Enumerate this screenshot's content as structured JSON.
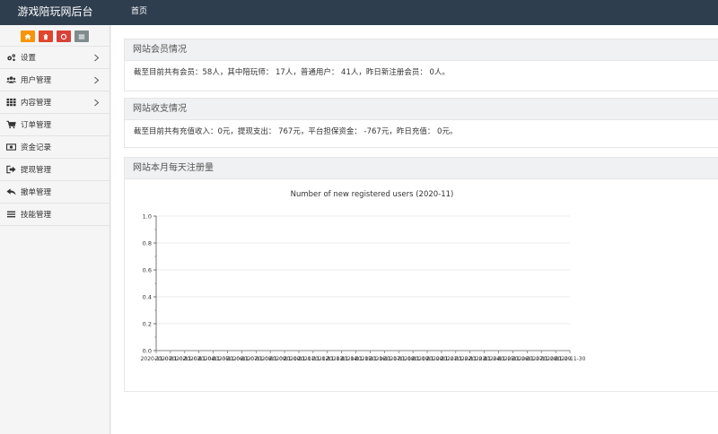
{
  "brand": "游戏陪玩网后台",
  "nav": {
    "home": "首页"
  },
  "shortcuts": [
    {
      "icon": "home-icon",
      "color": "#f89406"
    },
    {
      "icon": "trash-icon",
      "color": "#e0452d"
    },
    {
      "icon": "recycle-icon",
      "color": "#d9403a"
    },
    {
      "icon": "list-icon",
      "color": "#7f8c8d"
    }
  ],
  "menu": [
    {
      "label": "设置",
      "icon": "gears-icon",
      "has_children": true
    },
    {
      "label": "用户管理",
      "icon": "users-icon",
      "has_children": true
    },
    {
      "label": "内容管理",
      "icon": "grid-icon",
      "has_children": true
    },
    {
      "label": "订单管理",
      "icon": "cart-icon",
      "has_children": false
    },
    {
      "label": "资金记录",
      "icon": "money-icon",
      "has_children": false
    },
    {
      "label": "提现管理",
      "icon": "sign-out-icon",
      "has_children": false
    },
    {
      "label": "撤单管理",
      "icon": "reply-icon",
      "has_children": false
    },
    {
      "label": "技能管理",
      "icon": "bars-icon",
      "has_children": false
    }
  ],
  "members": {
    "title": "网站会员情况",
    "text": "截至目前共有会员：58人，其中陪玩师： 17人，普通用户： 41人，昨日新注册会员： 0人。"
  },
  "finance": {
    "title": "网站收支情况",
    "text": "截至目前共有充值收入：0元，提现支出： 767元，平台担保资金： -767元，昨日充值： 0元。"
  },
  "registrations": {
    "title": "网站本月每天注册量"
  },
  "chart_data": {
    "type": "line",
    "title": "Number of new registered users (2020-11)",
    "xlabel": "",
    "ylabel": "",
    "ylim": [
      0,
      1
    ],
    "yticks": [
      "0.0",
      "0.2",
      "0.4",
      "0.6",
      "0.8",
      "1.0"
    ],
    "categories": [
      "2020-11-01",
      "2020-11-02",
      "2020-11-03",
      "2020-11-04",
      "2020-11-05",
      "2020-11-06",
      "2020-11-07",
      "2020-11-08",
      "2020-11-09",
      "2020-11-10",
      "2020-11-11",
      "2020-11-12",
      "2020-11-13",
      "2020-11-14",
      "2020-11-15",
      "2020-11-16",
      "2020-11-17",
      "2020-11-18",
      "2020-11-19",
      "2020-11-20",
      "2020-11-21",
      "2020-11-22",
      "2020-11-23",
      "2020-11-24",
      "2020-11-25",
      "2020-11-26",
      "2020-11-27",
      "2020-11-28",
      "2020-11-29",
      "2020-11-30"
    ],
    "values": [
      0,
      0,
      0,
      0,
      0,
      0,
      0,
      0,
      0,
      0,
      0,
      0,
      0,
      0,
      0,
      0,
      0,
      0,
      0,
      0,
      0,
      0,
      0,
      0,
      0,
      0,
      0,
      0,
      0,
      0
    ],
    "grid": true,
    "colors": {
      "grid": "#e5e5e5",
      "axis": "#555555"
    }
  }
}
